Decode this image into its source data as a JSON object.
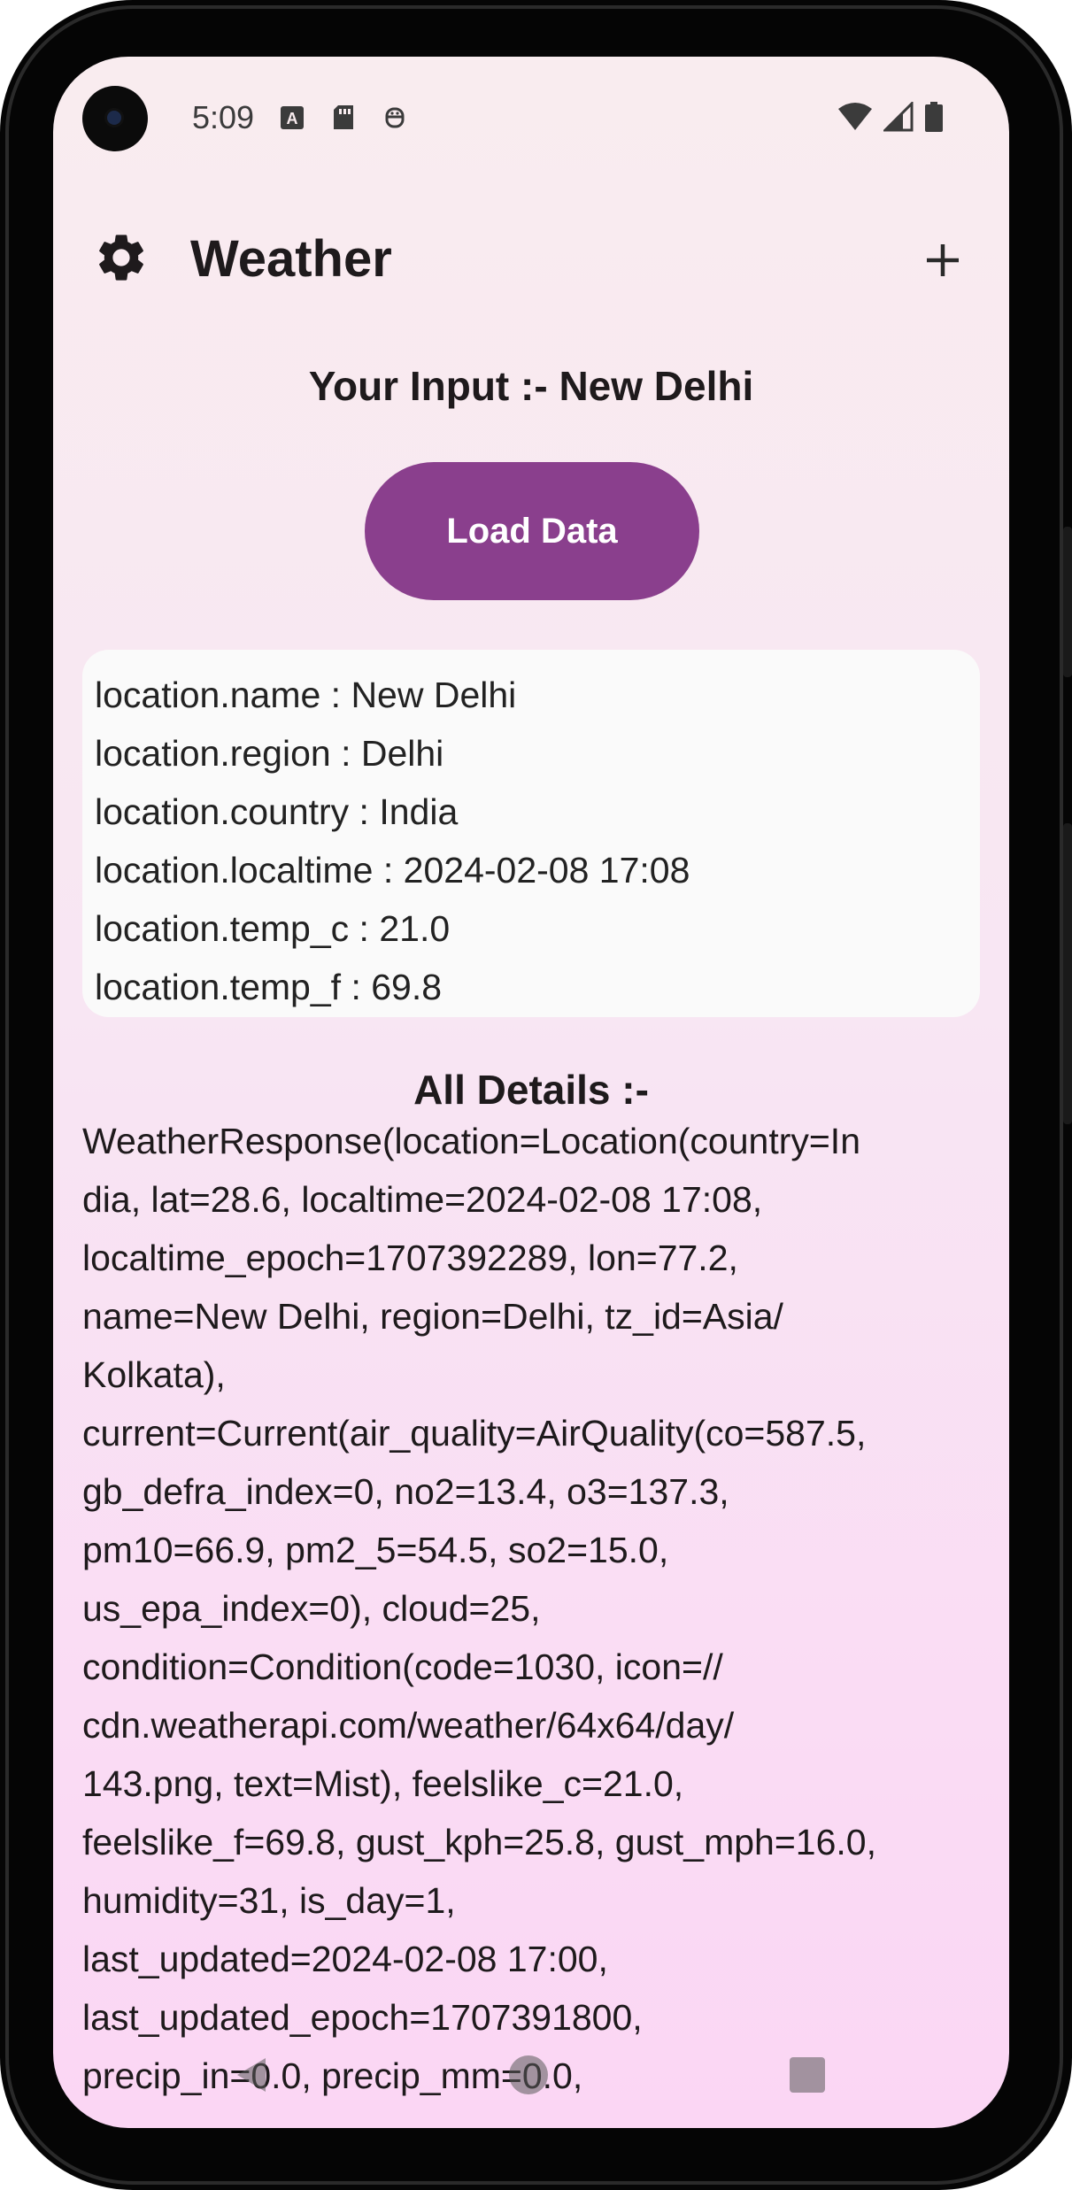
{
  "status_bar": {
    "time": "5:09"
  },
  "app_bar": {
    "title": "Weather"
  },
  "input_label": "Your Input :- New Delhi",
  "load_button_label": "Load Data",
  "location_card": {
    "lines": [
      "location.name : New Delhi",
      "location.region : Delhi",
      "location.country : India",
      "location.localtime : 2024-02-08 17:08",
      "location.temp_c : 21.0",
      "location.temp_f : 69.8"
    ]
  },
  "details": {
    "title": "All Details :-",
    "lines": [
      "WeatherResponse(location=Location(country=In",
      "dia, lat=28.6, localtime=2024-02-08 17:08,",
      "localtime_epoch=1707392289, lon=77.2,",
      "name=New Delhi, region=Delhi, tz_id=Asia/",
      "Kolkata),",
      "current=Current(air_quality=AirQuality(co=587.5,",
      "gb_defra_index=0, no2=13.4, o3=137.3,",
      "pm10=66.9, pm2_5=54.5, so2=15.0,",
      "us_epa_index=0), cloud=25,",
      "condition=Condition(code=1030, icon=//",
      "cdn.weatherapi.com/weather/64x64/day/",
      "143.png, text=Mist), feelslike_c=21.0,",
      "feelslike_f=69.8, gust_kph=25.8, gust_mph=16.0,",
      "humidity=31, is_day=1,",
      "last_updated=2024-02-08 17:00,",
      "last_updated_epoch=1707391800,",
      "precip_in=0.0, precip_mm=0.0,"
    ]
  },
  "colors": {
    "accent": "#8a3f8d",
    "background_top": "#f9ecef",
    "background_bottom": "#fbd6f4"
  },
  "icons": {
    "settings": "gear-icon",
    "add": "plus-icon",
    "wifi": "wifi-icon",
    "signal": "signal-icon",
    "battery": "battery-icon"
  }
}
